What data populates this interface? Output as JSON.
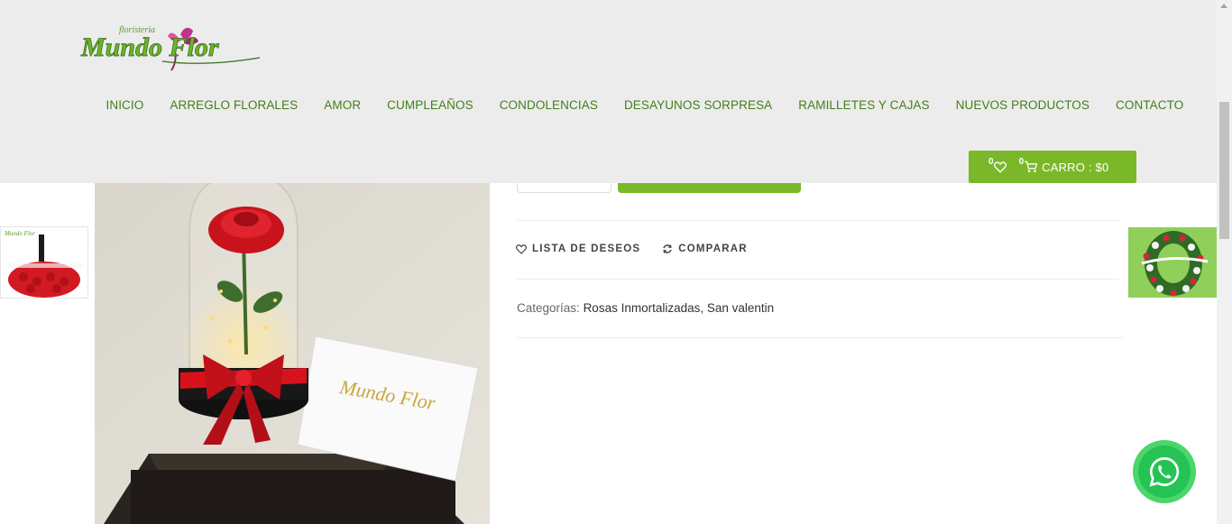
{
  "brand": {
    "logo_top": "floristeria",
    "logo_main": "Mundo Flor"
  },
  "nav": {
    "items": [
      {
        "label": "INICIO"
      },
      {
        "label": "ARREGLO FLORALES"
      },
      {
        "label": "AMOR"
      },
      {
        "label": "CUMPLEAÑOS"
      },
      {
        "label": "CONDOLENCIAS"
      },
      {
        "label": "DESAYUNOS SORPRESA"
      },
      {
        "label": "RAMILLETES Y CAJAS"
      },
      {
        "label": "NUEVOS PRODUCTOS"
      },
      {
        "label": "CONTACTO"
      }
    ]
  },
  "cart": {
    "wishlist_count": "0",
    "cart_count": "0",
    "label": "CARRO : $0"
  },
  "product": {
    "wishlist_label": "LISTA DE DESEOS",
    "compare_label": "COMPARAR",
    "categories_label": "Categorías:",
    "categories_value": "Rosas Inmortalizadas, San valentin",
    "card_logo": "Mundo Flor"
  },
  "colors": {
    "brand_green": "#7ab829",
    "nav_green": "#447f16",
    "header_bg": "#ececec",
    "whatsapp": "#25c354"
  },
  "icons": {
    "wishlist": "heart-icon",
    "compare": "refresh-icon",
    "cart": "cart-icon",
    "whatsapp": "whatsapp-icon"
  }
}
